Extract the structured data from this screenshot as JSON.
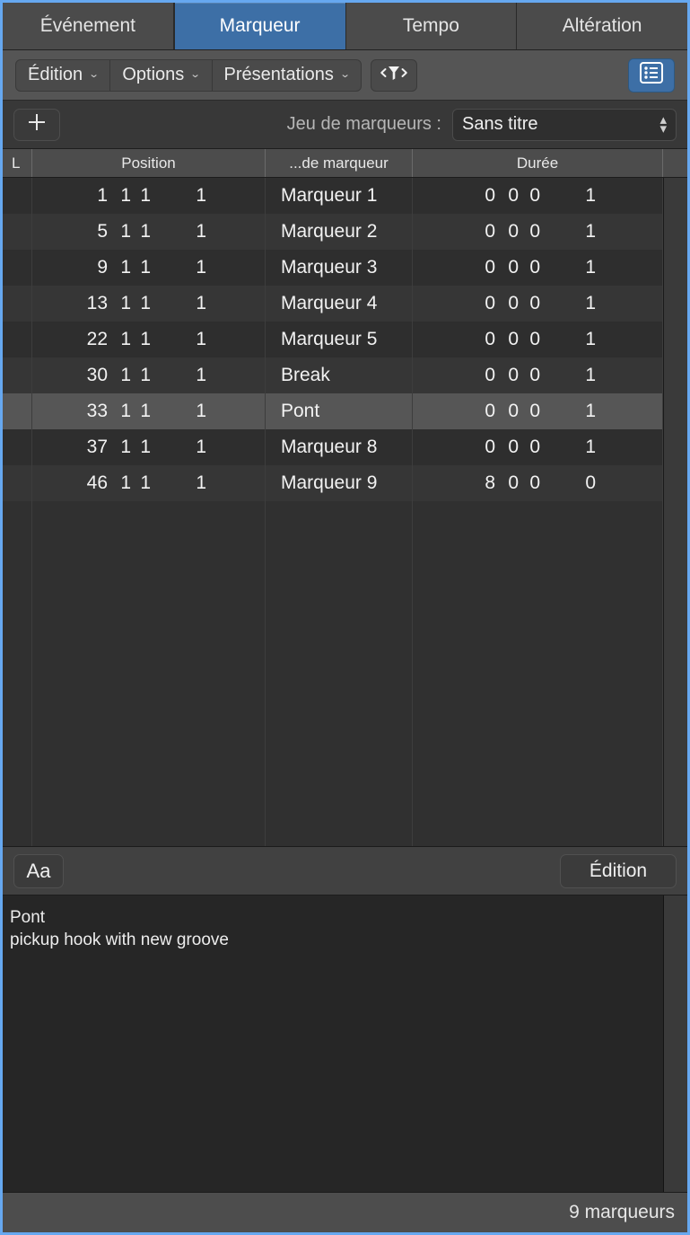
{
  "tabs": [
    {
      "label": "Événement",
      "active": false
    },
    {
      "label": "Marqueur",
      "active": true
    },
    {
      "label": "Tempo",
      "active": false
    },
    {
      "label": "Altération",
      "active": false
    }
  ],
  "toolbar": {
    "menus": [
      {
        "label": "Édition",
        "caret": "⌄"
      },
      {
        "label": "Options",
        "caret": "⌄"
      },
      {
        "label": "Présentations",
        "caret": "⌄"
      }
    ],
    "filter_button": {
      "icon": "funnel-filter-icon",
      "glyph": "›▼‹"
    },
    "list_button": {
      "icon": "list-view-icon",
      "active_color": "#3d6fa6"
    }
  },
  "setbar": {
    "add_button": {
      "icon": "plus-icon",
      "glyph": "+"
    },
    "label": "Jeu de marqueurs :",
    "selected_set": "Sans titre",
    "stepper_up": "▴",
    "stepper_down": "▾"
  },
  "table": {
    "columns": [
      {
        "key": "lock",
        "label": "L"
      },
      {
        "key": "position",
        "label": "Position"
      },
      {
        "key": "name",
        "label": "...de marqueur"
      },
      {
        "key": "duration",
        "label": "Durée"
      },
      {
        "key": "extra",
        "label": ""
      }
    ],
    "rows": [
      {
        "lock": "",
        "position": [
          "1",
          "1",
          "1",
          "1"
        ],
        "name": "Marqueur 1",
        "duration": [
          "0",
          "0",
          "0",
          "1"
        ],
        "selected": false
      },
      {
        "lock": "",
        "position": [
          "5",
          "1",
          "1",
          "1"
        ],
        "name": "Marqueur 2",
        "duration": [
          "0",
          "0",
          "0",
          "1"
        ],
        "selected": false
      },
      {
        "lock": "",
        "position": [
          "9",
          "1",
          "1",
          "1"
        ],
        "name": "Marqueur 3",
        "duration": [
          "0",
          "0",
          "0",
          "1"
        ],
        "selected": false
      },
      {
        "lock": "",
        "position": [
          "13",
          "1",
          "1",
          "1"
        ],
        "name": "Marqueur 4",
        "duration": [
          "0",
          "0",
          "0",
          "1"
        ],
        "selected": false
      },
      {
        "lock": "",
        "position": [
          "22",
          "1",
          "1",
          "1"
        ],
        "name": "Marqueur 5",
        "duration": [
          "0",
          "0",
          "0",
          "1"
        ],
        "selected": false
      },
      {
        "lock": "",
        "position": [
          "30",
          "1",
          "1",
          "1"
        ],
        "name": "Break",
        "duration": [
          "0",
          "0",
          "0",
          "1"
        ],
        "selected": false
      },
      {
        "lock": "",
        "position": [
          "33",
          "1",
          "1",
          "1"
        ],
        "name": "Pont",
        "duration": [
          "0",
          "0",
          "0",
          "1"
        ],
        "selected": true
      },
      {
        "lock": "",
        "position": [
          "37",
          "1",
          "1",
          "1"
        ],
        "name": "Marqueur 8",
        "duration": [
          "0",
          "0",
          "0",
          "1"
        ],
        "selected": false
      },
      {
        "lock": "",
        "position": [
          "46",
          "1",
          "1",
          "1"
        ],
        "name": "Marqueur 9",
        "duration": [
          "8",
          "0",
          "0",
          "0"
        ],
        "selected": false
      }
    ]
  },
  "notebar": {
    "font_button": "Aa",
    "edit_button": "Édition"
  },
  "note": {
    "text": "Pont\npickup hook with new groove"
  },
  "statusbar": {
    "count_text": "9 marqueurs"
  },
  "colors": {
    "accent_blue": "#3d6fa6",
    "window_border": "#66a8f0",
    "row_dark": "#2e2e2e",
    "row_light": "#363636",
    "row_selected": "#565656"
  }
}
